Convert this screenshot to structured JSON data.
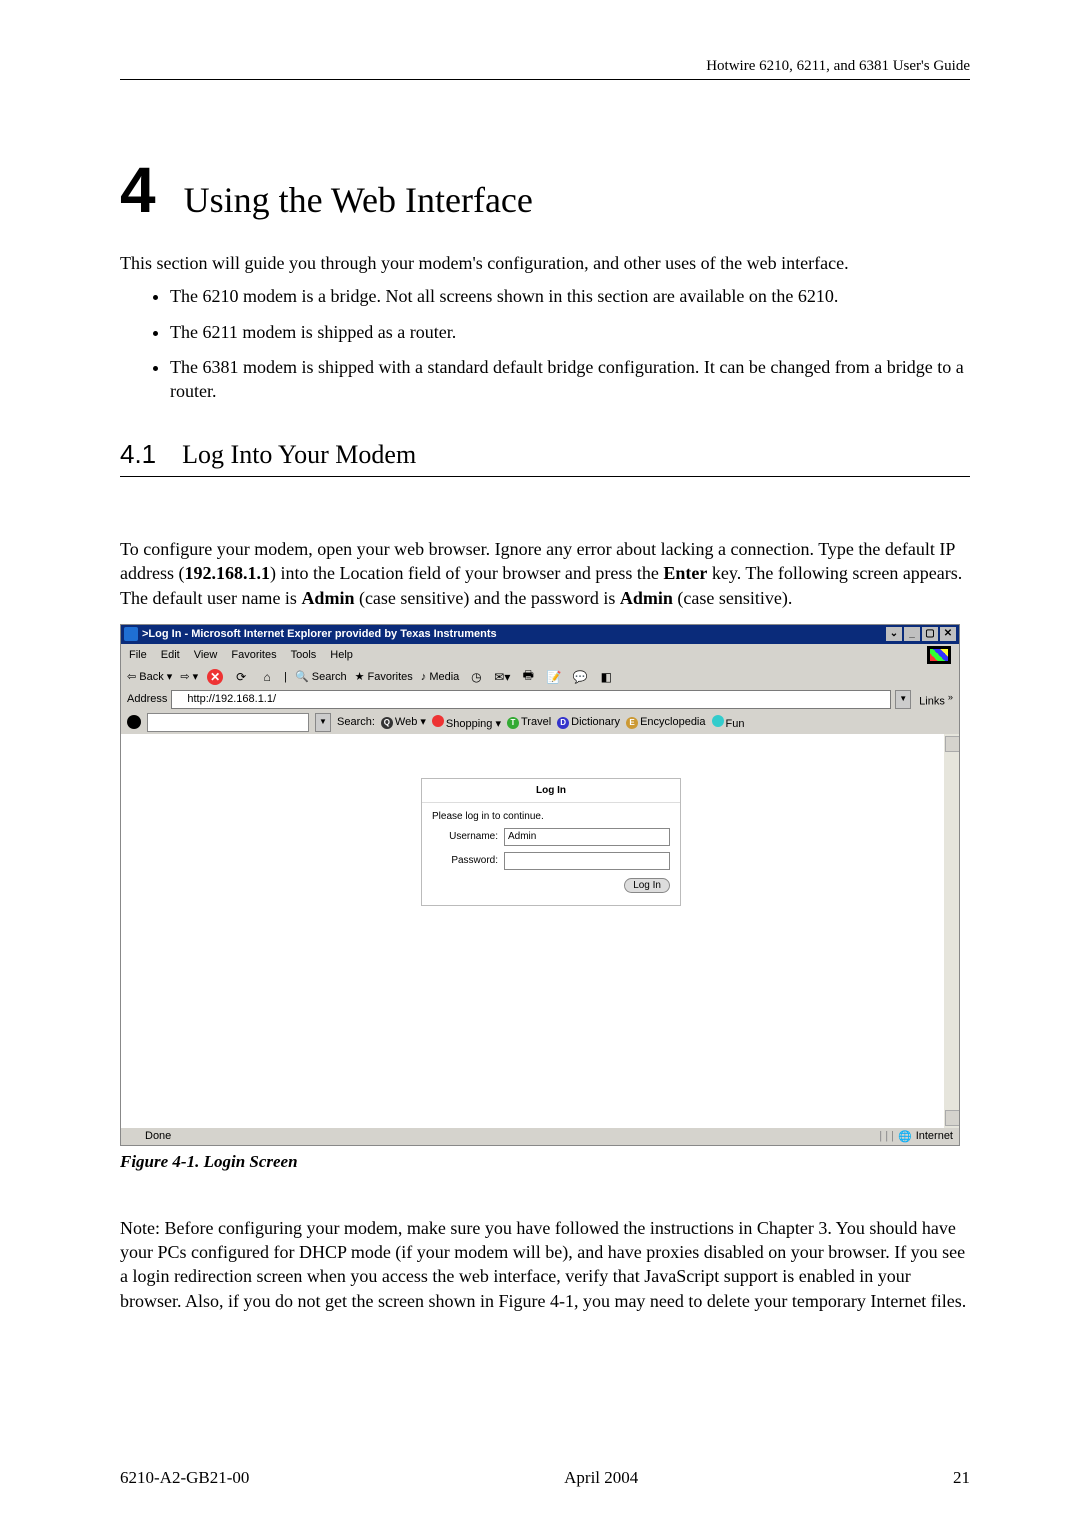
{
  "header": {
    "right": "Hotwire 6210, 6211, and 6381 User's Guide"
  },
  "chapter": {
    "number": "4",
    "title": "Using the Web Interface"
  },
  "intro": "This section will guide you through your modem's configuration, and other uses of the web interface.",
  "bullets": [
    "The 6210 modem is a bridge. Not all screens shown in this section are available on the 6210.",
    "The 6211 modem is shipped as a router.",
    "The 6381 modem is shipped with a standard default bridge configuration. It can be changed from a bridge to a router."
  ],
  "section": {
    "number": "4.1",
    "title": "Log Into Your Modem"
  },
  "para_pre": "To configure your modem, open your web browser. Ignore any error about lacking a connection. Type the default IP address (",
  "para_ip": "192.168.1.1",
  "para_mid1": ") into the Location field of your browser and press the ",
  "para_enter": "Enter",
  "para_mid2": " key. The following screen appears. The default user name is ",
  "para_admin1": "Admin",
  "para_mid3": " (case sensitive) and the password is ",
  "para_admin2": "Admin",
  "para_post": " (case sensitive).",
  "browser": {
    "window_title": ">Log In - Microsoft Internet Explorer provided by Texas Instruments",
    "menus": [
      "File",
      "Edit",
      "View",
      "Favorites",
      "Tools",
      "Help"
    ],
    "toolbar": {
      "back": "Back",
      "search": "Search",
      "favorites": "Favorites",
      "media": "Media"
    },
    "address_label": "Address",
    "address_value": "http://192.168.1.1/",
    "links_label": "Links",
    "search_label": "Search:",
    "chips": [
      {
        "letter": "Q",
        "bg": "#333",
        "label": "Web"
      },
      {
        "letter": "",
        "bg": "#e33",
        "label": "Shopping"
      },
      {
        "letter": "T",
        "bg": "#3a3",
        "label": "Travel"
      },
      {
        "letter": "D",
        "bg": "#33c",
        "label": "Dictionary"
      },
      {
        "letter": "E",
        "bg": "#c93",
        "label": "Encyclopedia"
      },
      {
        "letter": "",
        "bg": "#3cc",
        "label": "Fun"
      }
    ],
    "login": {
      "heading": "Log In",
      "prompt": "Please log in to continue.",
      "user_label": "Username:",
      "user_value": "Admin",
      "pass_label": "Password:",
      "button": "Log In"
    },
    "status_done": "Done",
    "status_zone": "Internet"
  },
  "caption": "Figure 4-1. Login Screen",
  "note": "Note: Before configuring your modem, make sure you have followed the instructions in Chapter 3. You should have your PCs configured for DHCP mode (if your modem will be), and have proxies disabled on your browser. If you see a login redirection screen when you access the web interface, verify that JavaScript support is enabled in your browser. Also, if you do not get the screen shown in Figure 4-1, you may need to delete your temporary Internet files.",
  "footer": {
    "left": "6210-A2-GB21-00",
    "center": "April 2004",
    "right": "21"
  }
}
